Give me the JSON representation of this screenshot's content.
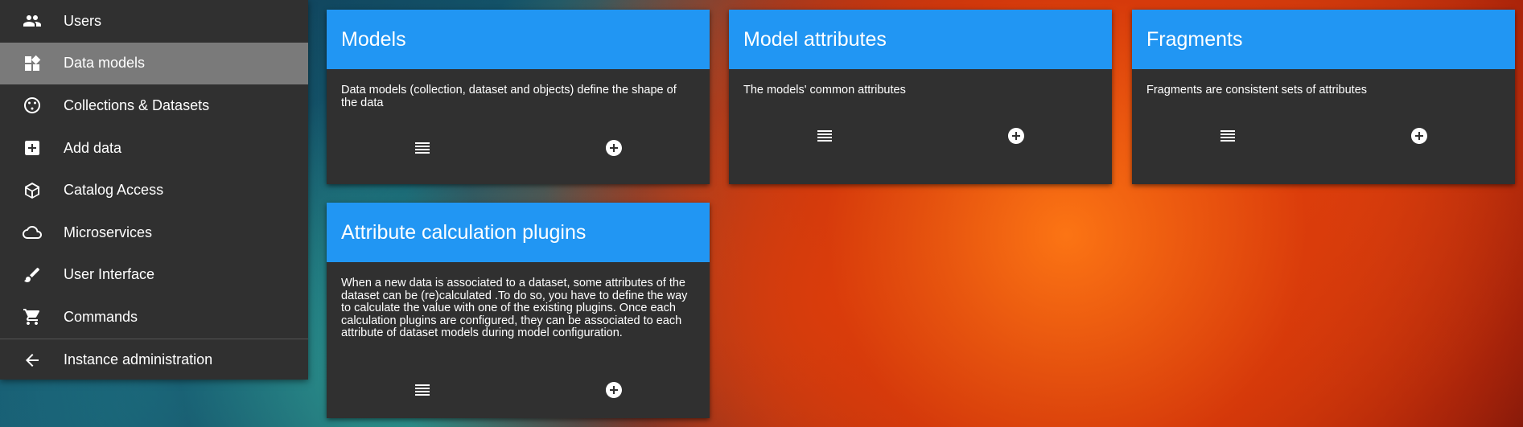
{
  "sidebar": {
    "items": [
      {
        "label": "Users",
        "icon": "users-icon"
      },
      {
        "label": "Data models",
        "icon": "widgets-icon",
        "active": true
      },
      {
        "label": "Collections & Datasets",
        "icon": "collections-icon"
      },
      {
        "label": "Add data",
        "icon": "add-box-icon"
      },
      {
        "label": "Catalog Access",
        "icon": "cube-icon"
      },
      {
        "label": "Microservices",
        "icon": "cloud-icon"
      },
      {
        "label": "User Interface",
        "icon": "brush-icon"
      },
      {
        "label": "Commands",
        "icon": "cart-icon"
      },
      {
        "label": "Instance administration",
        "icon": "arrow-back-icon"
      }
    ]
  },
  "cards": [
    {
      "title": "Models",
      "description": "Data models (collection, dataset and objects) define the shape of the data",
      "list_icon": "list-icon",
      "add_icon": "add-circle-icon"
    },
    {
      "title": "Model attributes",
      "description": "The models' common attributes",
      "list_icon": "list-icon",
      "add_icon": "add-circle-icon"
    },
    {
      "title": "Fragments",
      "description": "Fragments are consistent sets of attributes",
      "list_icon": "list-icon",
      "add_icon": "add-circle-icon"
    },
    {
      "title": "Attribute calculation plugins",
      "description": "When a new data is associated to a dataset, some attributes of the dataset can be (re)calculated .To do so, you have to define the way to calculate the value with one of the existing plugins. Once each calculation plugins are configured, they can be associated to each attribute of dataset models during model configuration.",
      "list_icon": "list-icon",
      "add_icon": "add-circle-icon"
    }
  ],
  "colors": {
    "card_header": "#2196f3",
    "card_body": "#303030",
    "sidebar_bg": "#303030",
    "sidebar_active": "#7a7a7a"
  }
}
